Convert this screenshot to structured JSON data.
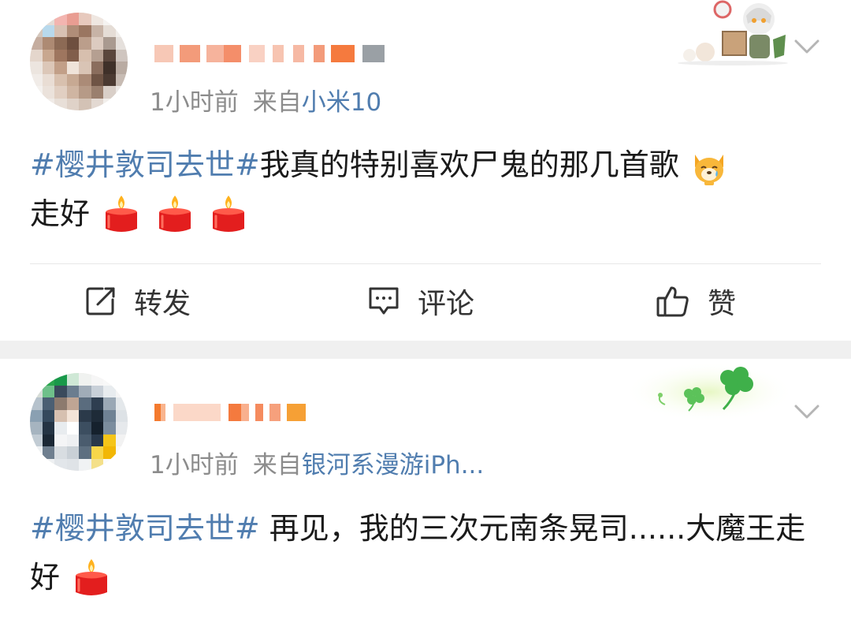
{
  "posts": [
    {
      "time": "1小时前",
      "from_prefix": "来自",
      "source": "小米10",
      "content": {
        "topic": "#樱井敦司去世#",
        "text": "我真的特别喜欢尸鬼的那几首歌",
        "text2": "走好"
      },
      "actions": {
        "repost": "转发",
        "comment": "评论",
        "like": "赞"
      }
    },
    {
      "time": "1小时前",
      "from_prefix": "来自",
      "source": "银河系漫游iPh...",
      "content": {
        "topic": "#樱井敦司去世#",
        "text": " 再见，我的三次元南条晃司......大魔王走好"
      }
    }
  ],
  "icons": {
    "chevron": "chevron-down-icon",
    "repost": "share-square-icon",
    "comment": "comment-bubble-icon",
    "like": "thumbs-up-icon",
    "candle": "candle-emoji",
    "dog": "crying-dog-emoji"
  },
  "colors": {
    "link": "#507daf",
    "meta": "#8c8c8c",
    "separator": "#f0f0f0"
  }
}
